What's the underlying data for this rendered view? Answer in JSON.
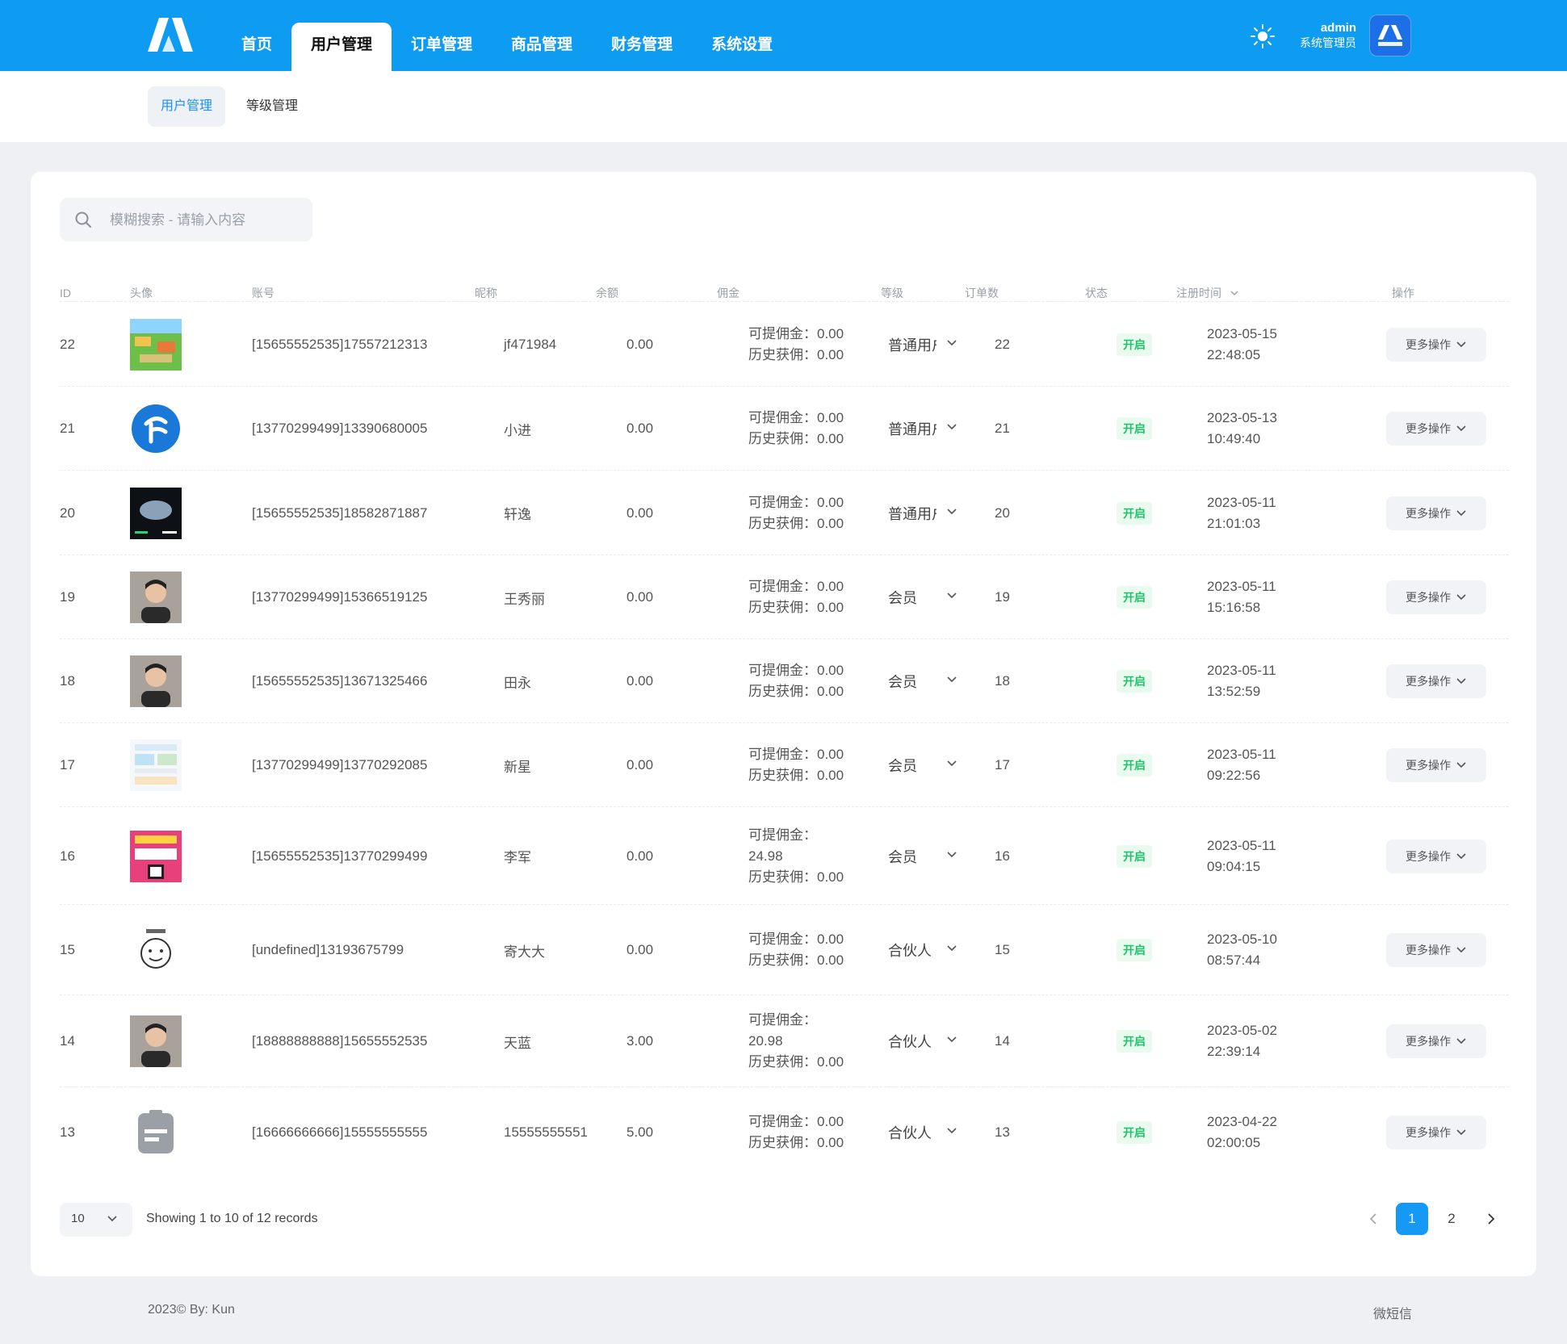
{
  "header": {
    "nav": [
      {
        "label": "首页",
        "active": false
      },
      {
        "label": "用户管理",
        "active": true
      },
      {
        "label": "订单管理",
        "active": false
      },
      {
        "label": "商品管理",
        "active": false
      },
      {
        "label": "财务管理",
        "active": false
      },
      {
        "label": "系统设置",
        "active": false
      }
    ],
    "user_name": "admin",
    "user_role": "系统管理员",
    "accent_color": "#0e9bf2"
  },
  "subnav": {
    "tabs": [
      {
        "label": "用户管理",
        "active": true
      },
      {
        "label": "等级管理",
        "active": false
      }
    ]
  },
  "search": {
    "placeholder": "模糊搜索 - 请输入内容"
  },
  "table": {
    "columns": [
      "ID",
      "头像",
      "账号",
      "昵称",
      "余额",
      "佣金",
      "等级",
      "订单数",
      "状态",
      "注册时间",
      "操作"
    ],
    "sort_column": "注册时间",
    "rows": [
      {
        "id": "22",
        "avatar": "game-image",
        "account": "[15655552535]17557212313",
        "nickname": "jf471984",
        "balance": "0.00",
        "comm_a": "可提佣金：0.00",
        "comm_b": "历史获佣：0.00",
        "level": "普通用户",
        "orders": "22",
        "status": "开启",
        "date": "2023-05-15",
        "time": "22:48:05",
        "op": "更多操作"
      },
      {
        "id": "21",
        "avatar": "telecom-logo",
        "account": "[13770299499]13390680005",
        "nickname": "小进",
        "balance": "0.00",
        "comm_a": "可提佣金：0.00",
        "comm_b": "历史获佣：0.00",
        "level": "普通用户",
        "orders": "21",
        "status": "开启",
        "date": "2023-05-13",
        "time": "10:49:40",
        "op": "更多操作"
      },
      {
        "id": "20",
        "avatar": "planet-dark",
        "account": "[15655552535]18582871887",
        "nickname": "轩逸",
        "balance": "0.00",
        "comm_a": "可提佣金：0.00",
        "comm_b": "历史获佣：0.00",
        "level": "普通用户",
        "orders": "20",
        "status": "开启",
        "date": "2023-05-11",
        "time": "21:01:03",
        "op": "更多操作"
      },
      {
        "id": "19",
        "avatar": "person-photo",
        "account": "[13770299499]15366519125",
        "nickname": "王秀丽",
        "balance": "0.00",
        "comm_a": "可提佣金：0.00",
        "comm_b": "历史获佣：0.00",
        "level": "会员",
        "orders": "19",
        "status": "开启",
        "date": "2023-05-11",
        "time": "15:16:58",
        "op": "更多操作"
      },
      {
        "id": "18",
        "avatar": "person-photo",
        "account": "[15655552535]13671325466",
        "nickname": "田永",
        "balance": "0.00",
        "comm_a": "可提佣金：0.00",
        "comm_b": "历史获佣：0.00",
        "level": "会员",
        "orders": "18",
        "status": "开启",
        "date": "2023-05-11",
        "time": "13:52:59",
        "op": "更多操作"
      },
      {
        "id": "17",
        "avatar": "screenshot-thumb",
        "account": "[13770299499]13770292085",
        "nickname": "新星",
        "balance": "0.00",
        "comm_a": "可提佣金：0.00",
        "comm_b": "历史获佣：0.00",
        "level": "会员",
        "orders": "17",
        "status": "开启",
        "date": "2023-05-11",
        "time": "09:22:56",
        "op": "更多操作"
      },
      {
        "id": "16",
        "avatar": "poster-thumb",
        "account": "[15655552535]13770299499",
        "nickname": "李军",
        "balance": "0.00",
        "comm_a": "可提佣金：",
        "comm_a2": "24.98",
        "comm_b": "历史获佣：0.00",
        "level": "会员",
        "orders": "16",
        "status": "开启",
        "date": "2023-05-11",
        "time": "09:04:15",
        "op": "更多操作"
      },
      {
        "id": "15",
        "avatar": "meme-face",
        "account": "[undefined]13193675799",
        "nickname": "寄大大",
        "balance": "0.00",
        "comm_a": "可提佣金：0.00",
        "comm_b": "历史获佣：0.00",
        "level": "合伙人",
        "orders": "15",
        "status": "开启",
        "date": "2023-05-10",
        "time": "08:57:44",
        "op": "更多操作"
      },
      {
        "id": "14",
        "avatar": "person-photo",
        "account": "[18888888888]15655552535",
        "nickname": "天蓝",
        "balance": "3.00",
        "comm_a": "可提佣金：",
        "comm_a2": "20.98",
        "comm_b": "历史获佣：0.00",
        "level": "合伙人",
        "orders": "14",
        "status": "开启",
        "date": "2023-05-02",
        "time": "22:39:14",
        "op": "更多操作"
      },
      {
        "id": "13",
        "avatar": "default-file-icon",
        "account": "[16666666666]15555555555",
        "nickname": "15555555551",
        "balance": "5.00",
        "comm_a": "可提佣金：0.00",
        "comm_b": "历史获佣：0.00",
        "level": "合伙人",
        "orders": "13",
        "status": "开启",
        "date": "2023-04-22",
        "time": "02:00:05",
        "op": "更多操作"
      }
    ]
  },
  "pagination": {
    "page_size": "10",
    "summary": "Showing 1 to 10 of 12 records",
    "pages": [
      "1",
      "2"
    ],
    "current": "1"
  },
  "footer": {
    "left": "2023© By: Kun",
    "right": "微短信"
  },
  "colors": {
    "status_green": "#1fc16b",
    "pager_active": "#1599f5"
  }
}
